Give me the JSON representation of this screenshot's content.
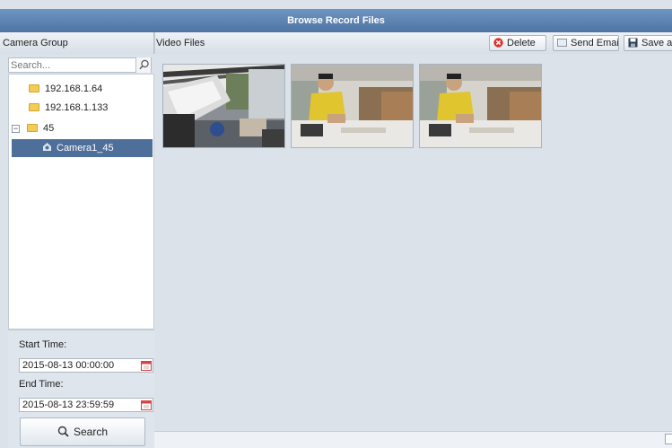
{
  "window": {
    "title": "Browse Record Files"
  },
  "left_panel": {
    "header": "Camera Group",
    "search_placeholder": "Search...",
    "tree": [
      {
        "label": "192.168.1.64",
        "type": "folder"
      },
      {
        "label": "192.168.1.133",
        "type": "folder"
      },
      {
        "label": "45",
        "type": "folder",
        "expanded": true
      },
      {
        "label": "Camera1_45",
        "type": "camera",
        "selected": true
      }
    ],
    "start_time_label": "Start Time:",
    "start_time_value": "2015-08-13 00:00:00",
    "end_time_label": "End Time:",
    "end_time_value": "2015-08-13 23:59:59",
    "search_button": "Search"
  },
  "right_panel": {
    "header": "Video Files",
    "toolbar": {
      "delete_label": "Delete",
      "send_email_label": "Send Email",
      "save_as_label": "Save as"
    },
    "thumbnails": [
      {
        "name": "video-thumbnail-1"
      },
      {
        "name": "video-thumbnail-2"
      },
      {
        "name": "video-thumbnail-3"
      }
    ]
  },
  "colors": {
    "title_bar": "#5a80ae",
    "selection": "#4e6f99",
    "delete_icon": "#d9342b",
    "folder": "#f2cc57"
  },
  "icons": [
    "search-icon",
    "delete-icon",
    "email-icon",
    "save-icon",
    "folder-icon",
    "camera-icon",
    "calendar-icon",
    "collapse-icon"
  ]
}
